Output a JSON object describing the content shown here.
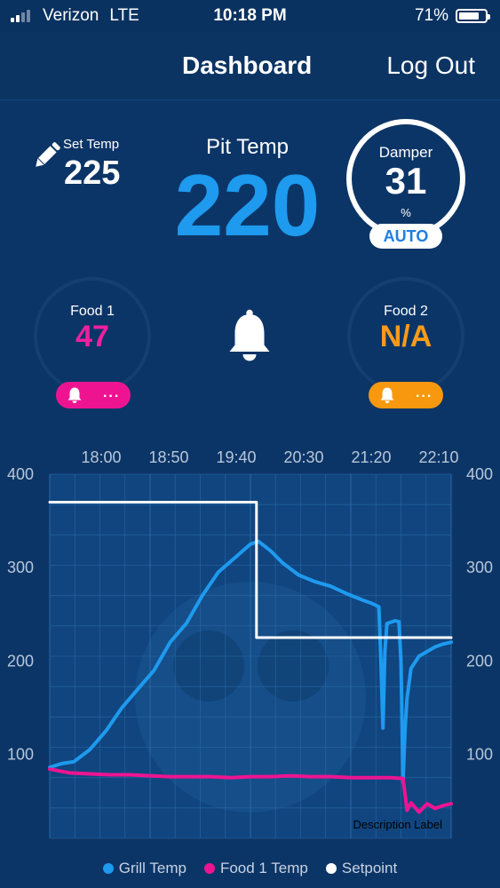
{
  "status_bar": {
    "carrier": "Verizon",
    "network": "LTE",
    "time": "10:18 PM",
    "battery": "71%"
  },
  "nav": {
    "title": "Dashboard",
    "logout": "Log Out"
  },
  "set_temp": {
    "label": "Set Temp",
    "value": "225"
  },
  "pit_temp": {
    "label": "Pit Temp",
    "value": "220"
  },
  "damper": {
    "label": "Damper",
    "value": "31",
    "unit": "%",
    "mode": "AUTO"
  },
  "food1": {
    "label": "Food 1",
    "value": "47",
    "menu": "..."
  },
  "food2": {
    "label": "Food  2",
    "value": "N/A",
    "menu": "..."
  },
  "icons": {
    "edit": "pencil-icon",
    "alarm": "bell-icon"
  },
  "colors": {
    "background": "#0c3567",
    "grill": "#1e9aef",
    "food1": "#ee1491",
    "food2": "#f7980f",
    "setpoint": "#ffffff"
  },
  "chart_data": {
    "type": "line",
    "x_ticks": [
      "18:00",
      "18:50",
      "19:40",
      "20:30",
      "21:20",
      "22:10"
    ],
    "y_ticks": [
      100,
      200,
      300,
      400
    ],
    "ylim": [
      10,
      400
    ],
    "grid": true,
    "legend_position": "bottom",
    "annotation": "Description Label",
    "series": [
      {
        "name": "Grill Temp",
        "color": "#1e9aef",
        "points": [
          [
            0,
            86
          ],
          [
            0.03,
            90
          ],
          [
            0.06,
            92
          ],
          [
            0.1,
            105
          ],
          [
            0.14,
            125
          ],
          [
            0.18,
            150
          ],
          [
            0.22,
            170
          ],
          [
            0.26,
            190
          ],
          [
            0.3,
            220
          ],
          [
            0.34,
            240
          ],
          [
            0.38,
            270
          ],
          [
            0.42,
            295
          ],
          [
            0.46,
            310
          ],
          [
            0.5,
            325
          ],
          [
            0.52,
            328
          ],
          [
            0.55,
            318
          ],
          [
            0.58,
            305
          ],
          [
            0.62,
            292
          ],
          [
            0.66,
            285
          ],
          [
            0.7,
            280
          ],
          [
            0.74,
            272
          ],
          [
            0.78,
            265
          ],
          [
            0.8,
            262
          ],
          [
            0.82,
            258
          ],
          [
            0.825,
            200
          ],
          [
            0.83,
            128
          ],
          [
            0.835,
            210
          ],
          [
            0.84,
            240
          ],
          [
            0.86,
            243
          ],
          [
            0.87,
            242
          ],
          [
            0.875,
            200
          ],
          [
            0.88,
            70
          ],
          [
            0.885,
            125
          ],
          [
            0.89,
            160
          ],
          [
            0.9,
            192
          ],
          [
            0.92,
            205
          ],
          [
            0.94,
            210
          ],
          [
            0.96,
            215
          ],
          [
            0.98,
            218
          ],
          [
            1.0,
            220
          ]
        ]
      },
      {
        "name": "Food 1 Temp",
        "color": "#ee1491",
        "points": [
          [
            0,
            84
          ],
          [
            0.05,
            80
          ],
          [
            0.1,
            79
          ],
          [
            0.15,
            78
          ],
          [
            0.2,
            78
          ],
          [
            0.25,
            77
          ],
          [
            0.3,
            76
          ],
          [
            0.35,
            76
          ],
          [
            0.4,
            76
          ],
          [
            0.45,
            75
          ],
          [
            0.5,
            76
          ],
          [
            0.55,
            76
          ],
          [
            0.6,
            77
          ],
          [
            0.65,
            76
          ],
          [
            0.7,
            76
          ],
          [
            0.75,
            75
          ],
          [
            0.8,
            75
          ],
          [
            0.85,
            75
          ],
          [
            0.88,
            74
          ],
          [
            0.89,
            40
          ],
          [
            0.9,
            48
          ],
          [
            0.92,
            38
          ],
          [
            0.94,
            47
          ],
          [
            0.96,
            42
          ],
          [
            0.98,
            45
          ],
          [
            1.0,
            47
          ]
        ]
      },
      {
        "name": "Setpoint",
        "color": "#ffffff",
        "points": [
          [
            0,
            370
          ],
          [
            0.515,
            370
          ],
          [
            0.515,
            225
          ],
          [
            1.0,
            225
          ]
        ]
      }
    ]
  }
}
